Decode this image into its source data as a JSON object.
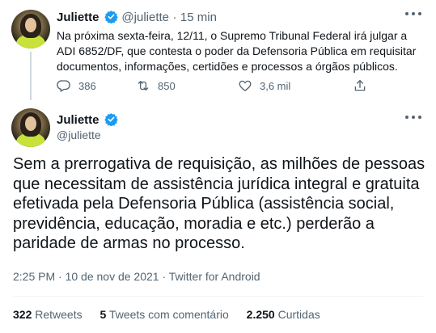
{
  "tweet1": {
    "name": "Juliette",
    "handle": "@juliette",
    "separator": "·",
    "time": "15 min",
    "text": "Na próxima sexta-feira, 12/11, o Supremo Tribunal Federal irá julgar a ADI 6852/DF, que contesta o poder da Defensoria Pública em requisitar documentos, informações, certidões e processos a órgãos públicos.",
    "replies": "386",
    "retweets": "850",
    "likes": "3,6 mil"
  },
  "tweet2": {
    "name": "Juliette",
    "handle": "@juliette",
    "text": "Sem a prerrogativa de requisição, as milhões de pessoas que necessitam de assistência jurídica integral e gratuita efetivada pela Defensoria Pública (assistência social, previdência, educação, moradia e etc.) perderão a paridade de armas no processo.",
    "meta": "2:25 PM · 10 de nov de 2021 · Twitter for Android",
    "stats": {
      "retweets_count": "322",
      "retweets_label": "Retweets",
      "quotes_count": "5",
      "quotes_label": "Tweets com comentário",
      "likes_count": "2.250",
      "likes_label": "Curtidas"
    }
  },
  "colors": {
    "verified": "#1d9bf0",
    "muted": "#536471",
    "text": "#0f1419"
  }
}
